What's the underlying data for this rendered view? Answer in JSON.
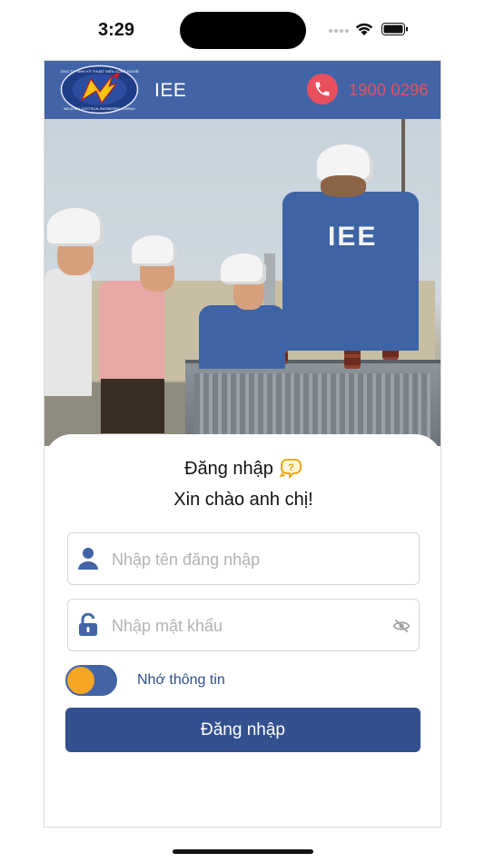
{
  "status_bar": {
    "time": "3:29"
  },
  "header": {
    "app_name": "IEE",
    "hotline": "1900 0296",
    "logo_name": "IEE logo",
    "logo_text": "CÔNG TY TNHH KỸ THUẬT ĐIỆN CÔNG NGHIỆP",
    "logo_subtext": "INDUSTRIAL ELECTRICAL ENGINEERING COMPANY"
  },
  "hero": {
    "jacket_text": "IEE"
  },
  "login": {
    "title": "Đăng nhập",
    "greeting": "Xin chào anh chị!",
    "username_placeholder": "Nhập tên đăng nhập",
    "password_placeholder": "Nhập mật khẩu",
    "remember_label": "Nhớ thông tin",
    "remember_enabled": true,
    "submit_label": "Đăng nhập"
  },
  "icons": {
    "title_icon": "help-chat-icon",
    "username_icon": "user-icon",
    "password_icon": "unlock-icon",
    "visibility_icon": "eye-off-icon",
    "call_icon": "phone-icon"
  },
  "colors": {
    "primary": "#4264a6",
    "button": "#33508f",
    "accent_orange": "#f5a623",
    "hotline_red": "#e9505e",
    "remember_text": "#2f4f8a"
  }
}
